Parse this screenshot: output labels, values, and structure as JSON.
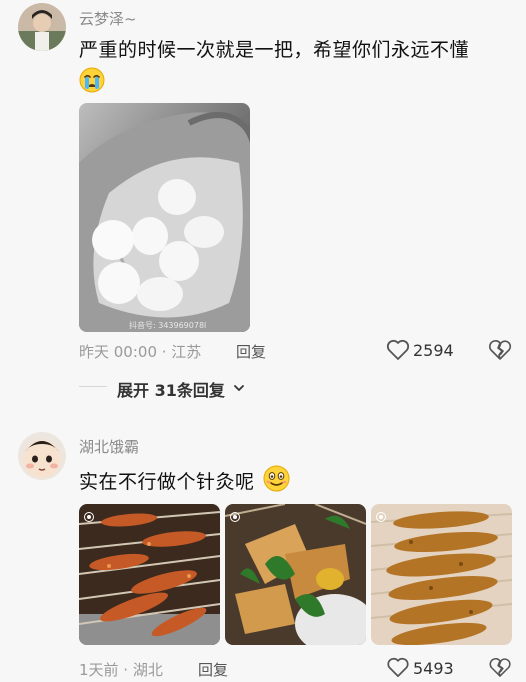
{
  "comments": [
    {
      "username": "云梦泽~",
      "text": "严重的时候一次就是一把，希望你们永远不懂",
      "emoji": "crying-emoji",
      "photo_watermark": "抖音号: 343969078l",
      "time_location": "昨天 00:00 · 江苏",
      "reply_label": "回复",
      "likes": "2594",
      "expand_label": "展开 31条回复"
    },
    {
      "username": "湖北饿霸",
      "text": "实在不行做个针灸呢",
      "emoji": "smiling-emoji",
      "time_location": "1天前 · 湖北",
      "reply_label": "回复",
      "likes": "5493"
    }
  ],
  "colors": {
    "background": "#f7f7f7",
    "meta_text": "#9a9a9a",
    "primary_text": "#111111"
  }
}
